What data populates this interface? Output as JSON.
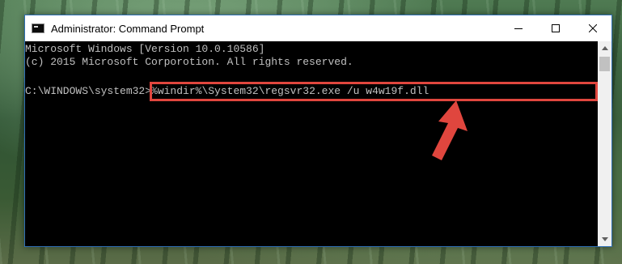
{
  "window": {
    "title": "Administrator: Command Prompt",
    "icon": "cmd-icon"
  },
  "caption_buttons": {
    "minimize_icon": "minimize-icon",
    "maximize_icon": "maximize-icon",
    "close_icon": "close-icon"
  },
  "console": {
    "lines": [
      "Microsoft Windows [Version 10.0.10586]",
      "(c) 2015 Microsoft Corporotion. All rights reserved.",
      "",
      "C:\\WINDOWS\\system32>%windir%\\System32\\regsvr32.exe /u w4w19f.dll"
    ],
    "prompt": "C:\\WINDOWS\\system32>",
    "command": "%windir%\\System32\\regsvr32.exe /u w4w19f.dll"
  },
  "annotation": {
    "highlight_color": "#e0463e",
    "arrow_color": "#e0463e"
  },
  "colors": {
    "console_bg": "#000000",
    "console_text": "#c0c0c0",
    "titlebar_bg": "#ffffff"
  }
}
